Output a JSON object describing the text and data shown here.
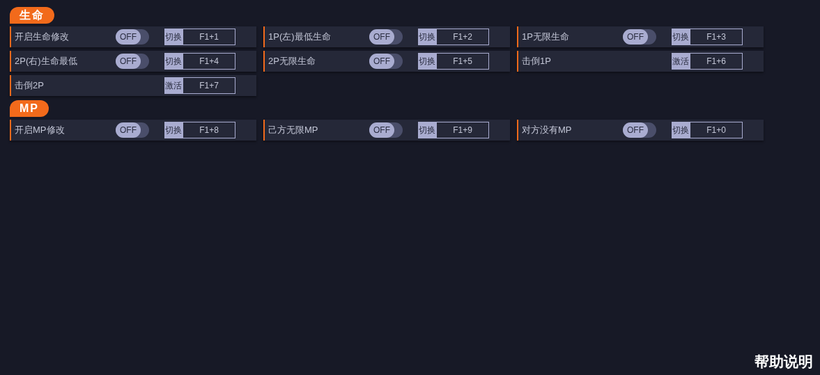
{
  "sections": [
    {
      "title": "生命",
      "items": [
        {
          "kind": "toggle",
          "label": "开启生命修改",
          "on": false,
          "switch_text": "OFF",
          "action": "切换",
          "hotkey": "F1+1"
        },
        {
          "kind": "toggle",
          "label": "1P(左)最低生命",
          "on": false,
          "switch_text": "OFF",
          "action": "切换",
          "hotkey": "F1+2"
        },
        {
          "kind": "toggle",
          "label": "1P无限生命",
          "on": false,
          "switch_text": "OFF",
          "action": "切换",
          "hotkey": "F1+3"
        },
        {
          "kind": "toggle",
          "label": "2P(右)生命最低",
          "on": false,
          "switch_text": "OFF",
          "action": "切换",
          "hotkey": "F1+4"
        },
        {
          "kind": "toggle",
          "label": "2P无限生命",
          "on": false,
          "switch_text": "OFF",
          "action": "切换",
          "hotkey": "F1+5"
        },
        {
          "kind": "button",
          "label": "击倒1P",
          "action": "激活",
          "hotkey": "F1+6"
        },
        {
          "kind": "button",
          "label": "击倒2P",
          "action": "激活",
          "hotkey": "F1+7"
        }
      ]
    },
    {
      "title": "MP",
      "items": [
        {
          "kind": "toggle",
          "label": "开启MP修改",
          "on": false,
          "switch_text": "OFF",
          "action": "切换",
          "hotkey": "F1+8"
        },
        {
          "kind": "toggle",
          "label": "己方无限MP",
          "on": false,
          "switch_text": "OFF",
          "action": "切换",
          "hotkey": "F1+9"
        },
        {
          "kind": "toggle",
          "label": "对方没有MP",
          "on": false,
          "switch_text": "OFF",
          "action": "切换",
          "hotkey": "F1+0"
        }
      ]
    }
  ],
  "help": "帮助说明"
}
